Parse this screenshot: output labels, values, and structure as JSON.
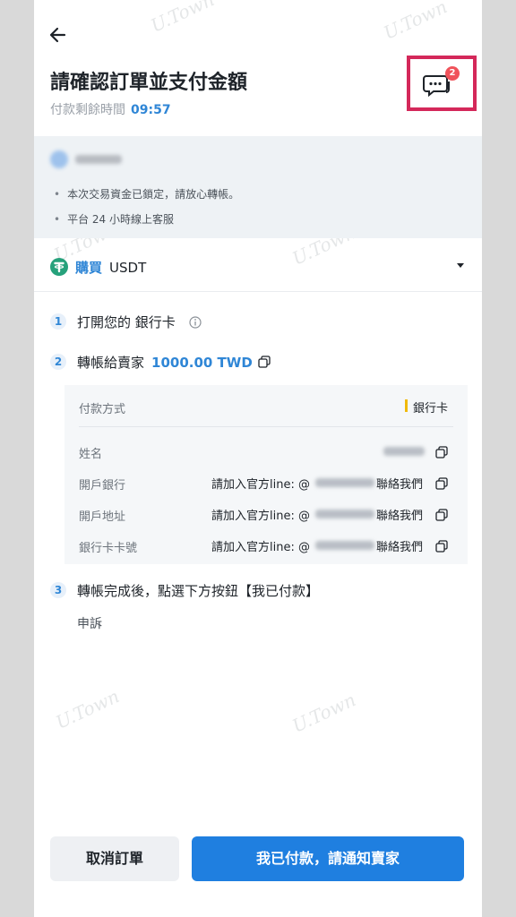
{
  "header": {
    "title": "請確認訂單並支付金額",
    "timer_label": "付款剩餘時間",
    "timer_value": "09:57",
    "chat_badge": "2",
    "back_icon": "arrow-left-icon",
    "chat_icon": "chat-bubble-icon"
  },
  "notice": {
    "bullets": [
      "本次交易資金已鎖定，請放心轉帳。",
      "平台 24 小時線上客服"
    ]
  },
  "trade": {
    "action": "購買",
    "coin": "USDT",
    "coin_icon": "tether-icon"
  },
  "steps": {
    "step1": {
      "num": "1",
      "text": "打開您的 銀行卡"
    },
    "step2": {
      "num": "2",
      "text": "轉帳給賣家",
      "amount": "1000.00 TWD"
    },
    "step3": {
      "num": "3",
      "text": "轉帳完成後，點選下方按鈕【我已付款】"
    }
  },
  "payment": {
    "method_label": "付款方式",
    "method_value": "銀行卡",
    "rows": [
      {
        "label": "姓名",
        "prefix": "",
        "suffix": ""
      },
      {
        "label": "開戶銀行",
        "prefix": "請加入官方line: @",
        "suffix": "聯絡我們"
      },
      {
        "label": "開戶地址",
        "prefix": "請加入官方line: @",
        "suffix": "聯絡我們"
      },
      {
        "label": "銀行卡卡號",
        "prefix": "請加入官方line: @",
        "suffix": "聯絡我們"
      }
    ]
  },
  "appeal_label": "申訴",
  "buttons": {
    "cancel": "取消訂單",
    "paid": "我已付款，請通知賣家"
  },
  "watermark": "U.Town",
  "colors": {
    "accent": "#2f86d6",
    "primary_button": "#1f7fe0",
    "badge": "#f0525a",
    "highlight_frame": "#d4285a",
    "payment_marker": "#f0b90b"
  }
}
